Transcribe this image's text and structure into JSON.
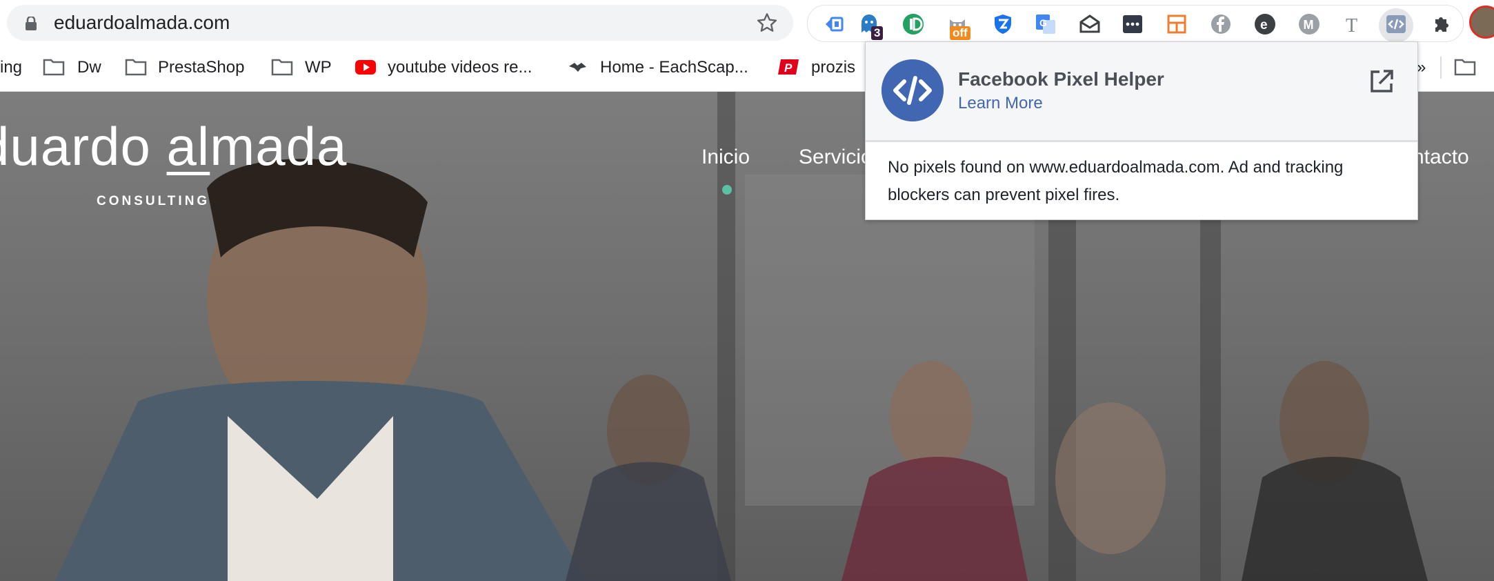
{
  "browser": {
    "url": "eduardoalmada.com",
    "extension_badges": {
      "ghostery": "3",
      "cat": "off"
    }
  },
  "bookmarks": [
    {
      "label": "ing",
      "icon": "folder-icon"
    },
    {
      "label": "Dw",
      "icon": "folder-icon"
    },
    {
      "label": "PrestaShop",
      "icon": "folder-icon"
    },
    {
      "label": "WP",
      "icon": "folder-icon"
    },
    {
      "label": "youtube videos re...",
      "icon": "youtube-icon"
    },
    {
      "label": "Home - EachScap...",
      "icon": "eachscape-icon"
    },
    {
      "label": "prozis",
      "icon": "prozis-icon"
    },
    {
      "label": "»",
      "icon": ""
    }
  ],
  "page": {
    "logo_text_pre": "duardo ",
    "logo_text_ul": "al",
    "logo_text_post": "mada",
    "logo_sub": "CONSULTING",
    "nav": {
      "inicio": "Inicio",
      "servicios": "Servicio",
      "contacto": "ntacto"
    }
  },
  "popup": {
    "title": "Facebook Pixel Helper",
    "link": "Learn More",
    "message": "No pixels found on www.eduardoalmada.com. Ad and tracking blockers can prevent pixel fires."
  },
  "colors": {
    "facebook_blue": "#4267b2",
    "accent_dot": "#5fbfa4",
    "youtube_red": "#ff0000"
  }
}
